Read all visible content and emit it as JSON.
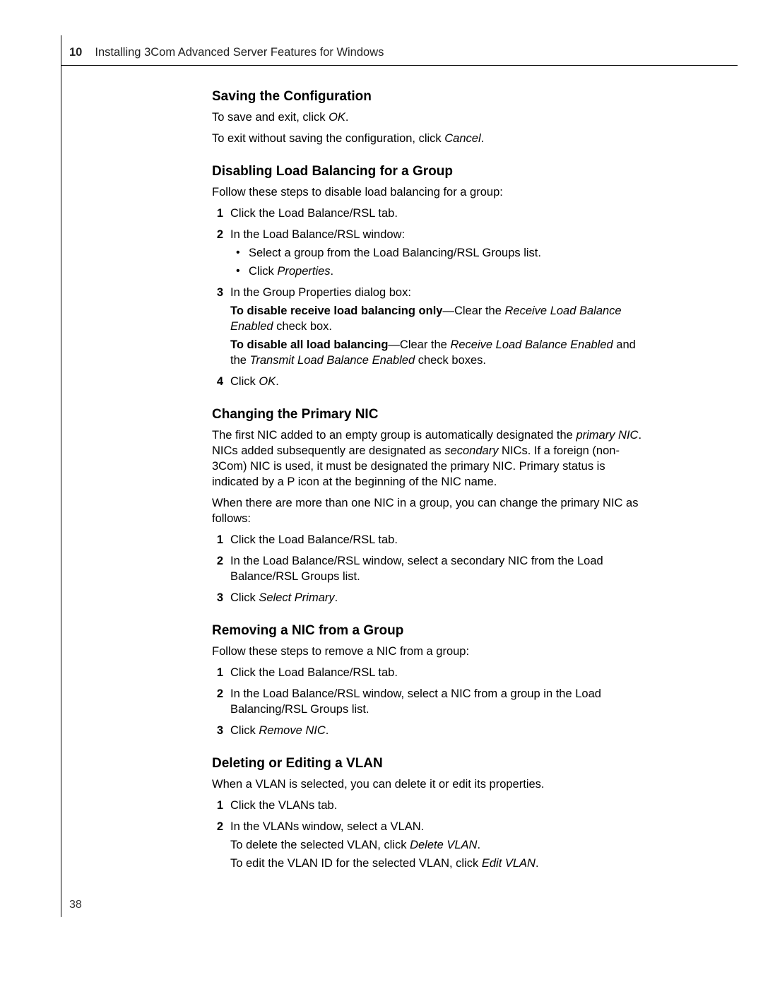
{
  "header": {
    "page_number_top": "10",
    "running_title": "Installing 3Com Advanced Server Features for Windows"
  },
  "footer": {
    "page_number_bottom": "38"
  },
  "sections": {
    "saving": {
      "title": "Saving the Configuration",
      "p1_a": "To save and exit, click ",
      "p1_em": "OK",
      "p1_b": ".",
      "p2_a": "To exit without saving the configuration, click ",
      "p2_em": "Cancel",
      "p2_b": "."
    },
    "disabling": {
      "title": "Disabling Load Balancing for a Group",
      "intro": "Follow these steps to disable load balancing for a group:",
      "steps": {
        "s1": "Click the Load Balance/RSL tab.",
        "s2": "In the Load Balance/RSL window:",
        "s2_sub1": "Select a group from the Load Balancing/RSL Groups list.",
        "s2_sub2_a": "Click ",
        "s2_sub2_em": "Properties",
        "s2_sub2_b": ".",
        "s3": "In the Group Properties dialog box:",
        "s3_line1_strong": "To disable receive load balancing only",
        "s3_line1_mid": "—Clear the ",
        "s3_line1_em": "Receive Load Balance Enabled",
        "s3_line1_end": " check box.",
        "s3_line2_strong": "To disable all load balancing",
        "s3_line2_mid": "—Clear the ",
        "s3_line2_em1": "Receive Load Balance Enabled",
        "s3_line2_mid2": " and the ",
        "s3_line2_em2": "Transmit Load Balance Enabled",
        "s3_line2_end": " check boxes.",
        "s4_a": "Click ",
        "s4_em": "OK",
        "s4_b": "."
      }
    },
    "changing": {
      "title": "Changing the Primary NIC",
      "p1_a": "The first NIC added to an empty group is automatically designated the ",
      "p1_em1": "primary NIC",
      "p1_b": ". NICs added subsequently are designated as ",
      "p1_em2": "secondary",
      "p1_c": " NICs. If a foreign (non-3Com) NIC is used, it must be designated the primary NIC. Primary status is indicated by a P icon at the beginning of the NIC name.",
      "p2": "When there are more than one NIC in a group, you can change the primary NIC as follows:",
      "steps": {
        "s1": "Click the Load Balance/RSL tab.",
        "s2": "In the Load Balance/RSL window, select a secondary NIC from the Load Balance/RSL Groups list.",
        "s3_a": "Click ",
        "s3_em": "Select Primary",
        "s3_b": "."
      }
    },
    "removing": {
      "title": "Removing a NIC from a Group",
      "intro": "Follow these steps to remove a NIC from a group:",
      "steps": {
        "s1": "Click the Load Balance/RSL tab.",
        "s2": "In the Load Balance/RSL window, select a NIC from a group in the Load Balancing/RSL Groups list.",
        "s3_a": "Click ",
        "s3_em": "Remove NIC",
        "s3_b": "."
      }
    },
    "vlan": {
      "title": "Deleting or Editing a VLAN",
      "intro": "When a VLAN is selected, you can delete it or edit its properties.",
      "steps": {
        "s1": "Click the VLANs tab.",
        "s2": "In the VLANs window, select a VLAN.",
        "s2_line1_a": "To delete the selected VLAN, click ",
        "s2_line1_em": "Delete VLAN",
        "s2_line1_b": ".",
        "s2_line2_a": "To edit the VLAN ID for the selected VLAN, click ",
        "s2_line2_em": "Edit VLAN",
        "s2_line2_b": "."
      }
    }
  }
}
